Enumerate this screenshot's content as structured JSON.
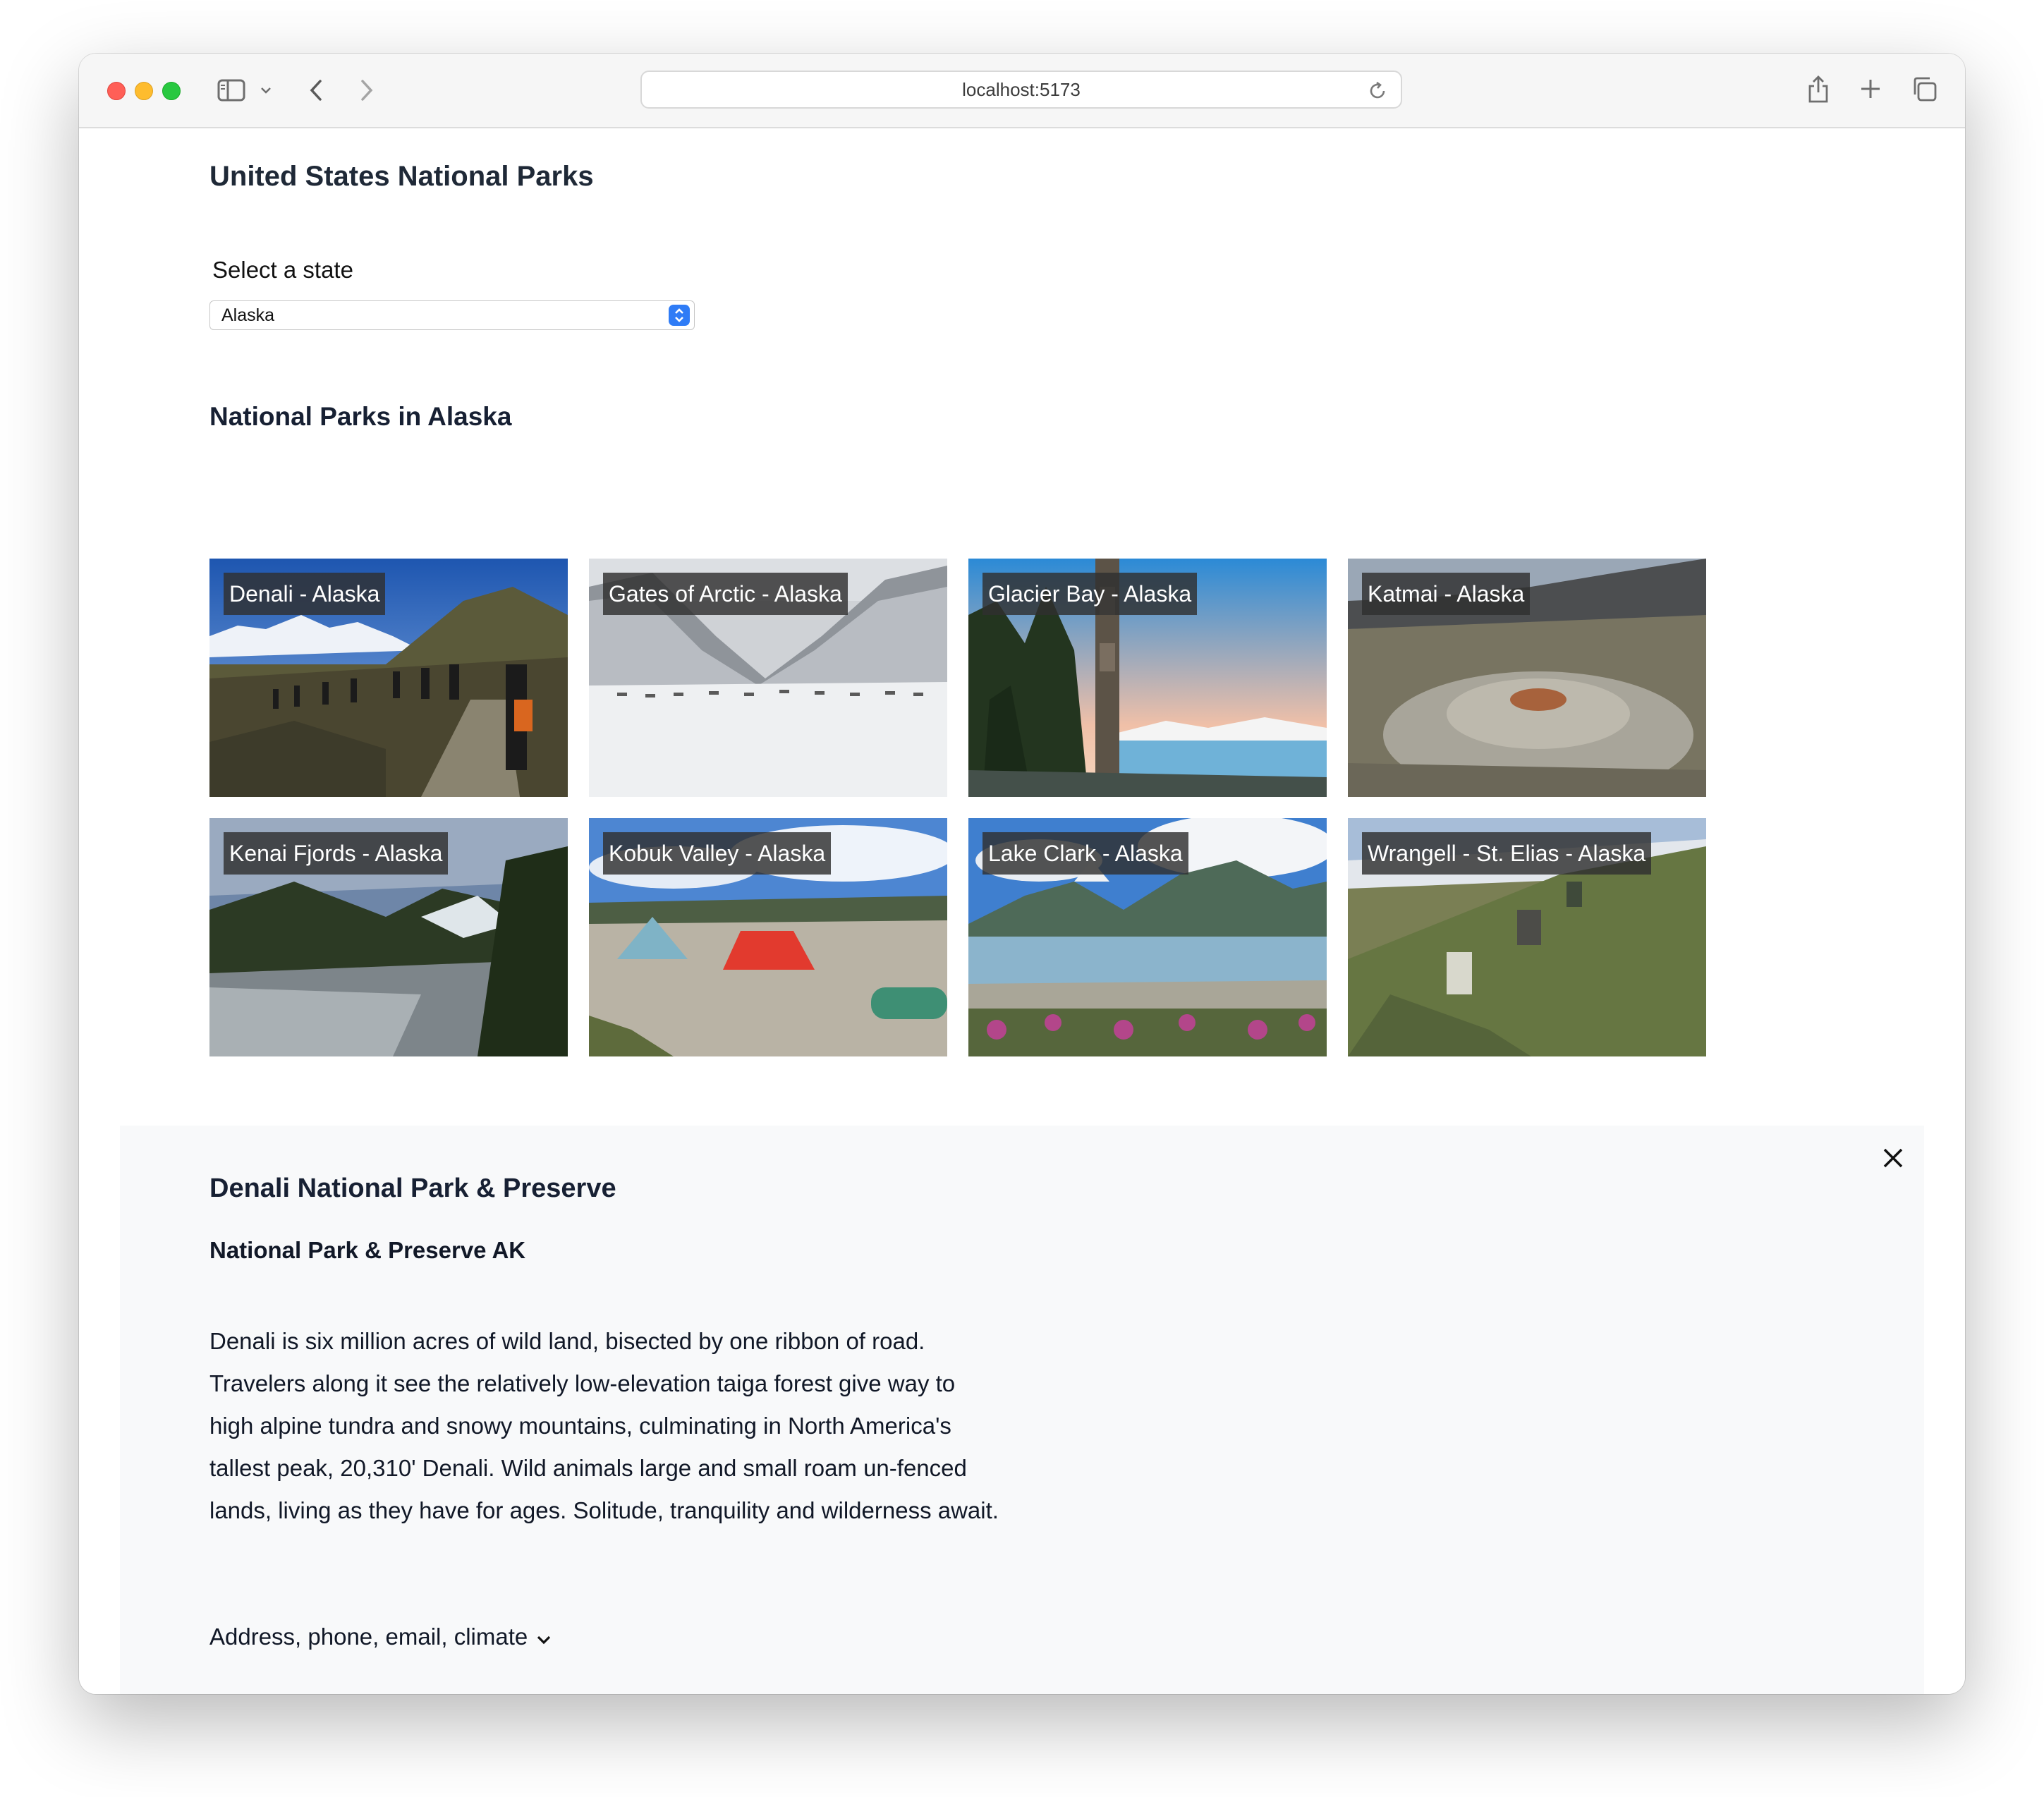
{
  "browser": {
    "url": "localhost:5173"
  },
  "page": {
    "title": "United States National Parks"
  },
  "state_select": {
    "label": "Select a state",
    "selected": "Alaska"
  },
  "parks_section": {
    "heading": "National Parks in Alaska",
    "parks": [
      {
        "label": "Denali - Alaska"
      },
      {
        "label": "Gates of Arctic - Alaska"
      },
      {
        "label": "Glacier Bay - Alaska"
      },
      {
        "label": "Katmai - Alaska"
      },
      {
        "label": "Kenai Fjords - Alaska"
      },
      {
        "label": "Kobuk Valley - Alaska"
      },
      {
        "label": "Lake Clark - Alaska"
      },
      {
        "label": "Wrangell - St. Elias - Alaska"
      }
    ]
  },
  "detail": {
    "title": "Denali National Park & Preserve",
    "designation": "National Park & Preserve AK",
    "description": "Denali is six million acres of wild land, bisected by one ribbon of road. Travelers along it see the relatively low-elevation taiga forest give way to high alpine tundra and snowy mountains, culminating in North America's tallest peak, 20,310' Denali. Wild animals large and small roam un-fenced lands, living as they have for ages. Solitude, tranquility and wilderness await.",
    "more_info_label": "Address, phone, email, climate"
  },
  "icons": {
    "select_arrows": "chevron-up-down-icon",
    "close": "close-icon",
    "expand": "chevron-down-icon"
  },
  "colors": {
    "select_accent": "#2f7cf6",
    "detail_background": "#f8f9fa",
    "label_background": "#303030"
  }
}
